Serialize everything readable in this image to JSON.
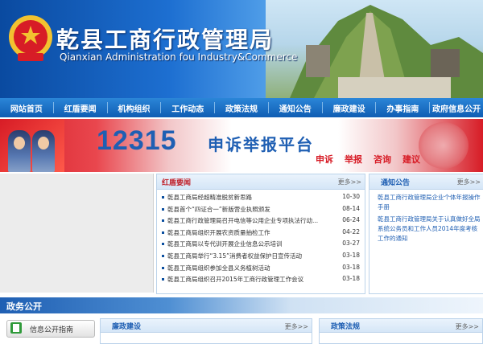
{
  "header": {
    "title_cn": "乾县工商行政管理局",
    "title_en": "Qianxian Administration fou Industry&Commerce"
  },
  "nav": {
    "items": [
      {
        "label": "网站首页"
      },
      {
        "label": "红盾要闻"
      },
      {
        "label": "机构组织"
      },
      {
        "label": "工作动态"
      },
      {
        "label": "政策法规"
      },
      {
        "label": "通知公告"
      },
      {
        "label": "廉政建设"
      },
      {
        "label": "办事指南"
      },
      {
        "label": "政府信息公开"
      }
    ]
  },
  "banner": {
    "number": "12315",
    "slogan": "申诉举报平台",
    "tags": [
      "申诉",
      "举报",
      "咨询",
      "建议"
    ]
  },
  "news": {
    "title": "红盾要闻",
    "more": "更多>>",
    "items": [
      {
        "text": "乾县工商局经超精准脱贫新思路",
        "date": "10-30"
      },
      {
        "text": "乾县首个“四证合一”新版营业执照颁发",
        "date": "08-14"
      },
      {
        "text": "乾县工商行政管理局召开电信等公用企业专项执法行动...",
        "date": "06-24"
      },
      {
        "text": "乾县工商局组织开展农资质量抽检工作",
        "date": "04-22"
      },
      {
        "text": "乾县工商局以专代训开展企业信息公示培训",
        "date": "03-27"
      },
      {
        "text": "乾县工商局举行“3.15”消费者权益保护日宣传活动",
        "date": "03-18"
      },
      {
        "text": "乾县工商局组织参加全县义务植树活动",
        "date": "03-18"
      },
      {
        "text": "乾县工商局组织召开2015年工商行政管理工作会议",
        "date": "03-18"
      }
    ]
  },
  "notice": {
    "title": "通知公告",
    "more": "更多>>",
    "items": [
      {
        "text": "乾县工商行政管理局企业个体年报操作手册"
      },
      {
        "text": "乾县工商行政管理局关于认真做好全局系统公务员和工作人员2014年度考核工作的通知"
      }
    ]
  },
  "gov": {
    "title": "政务公开",
    "guide_label": "信息公开指南",
    "panel1_title": "廉政建设",
    "panel1_more": "更多>>",
    "panel2_title": "政策法规",
    "panel2_more": "更多>>"
  },
  "colors": {
    "primary": "#1f5fb3",
    "accent_red": "#d71c26",
    "nav_bg": "#0f5db3"
  }
}
